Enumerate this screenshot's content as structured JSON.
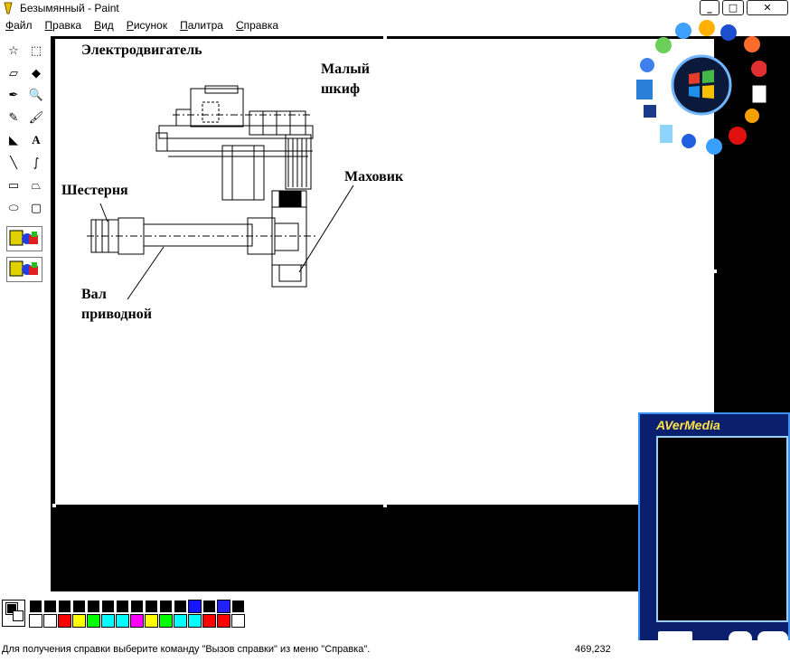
{
  "window": {
    "title": "Безымянный - Paint",
    "minimize_glyph": "_",
    "maximize_glyph": "□",
    "close_glyph": "✕"
  },
  "menu": {
    "items": [
      "Файл",
      "Правка",
      "Вид",
      "Рисунок",
      "Палитра",
      "Справка"
    ]
  },
  "toolbox": {
    "tools": [
      {
        "name": "free-select-icon",
        "glyph": "☆"
      },
      {
        "name": "rect-select-icon",
        "glyph": "⬚"
      },
      {
        "name": "eraser-icon",
        "glyph": "▱"
      },
      {
        "name": "fill-bucket-icon",
        "glyph": "◆"
      },
      {
        "name": "color-picker-icon",
        "glyph": "✒"
      },
      {
        "name": "magnifier-icon",
        "glyph": "🔍"
      },
      {
        "name": "pencil-icon",
        "glyph": "✎"
      },
      {
        "name": "brush-icon",
        "glyph": "🖌"
      },
      {
        "name": "airbrush-icon",
        "glyph": "◣"
      },
      {
        "name": "text-icon",
        "glyph": "A"
      },
      {
        "name": "line-icon",
        "glyph": "╲"
      },
      {
        "name": "curve-icon",
        "glyph": "∫"
      },
      {
        "name": "rectangle-icon",
        "glyph": "▭"
      },
      {
        "name": "polygon-icon",
        "glyph": "⏢"
      },
      {
        "name": "ellipse-icon",
        "glyph": "⬭"
      },
      {
        "name": "rounded-rect-icon",
        "glyph": "▢"
      }
    ]
  },
  "drawing": {
    "labels": {
      "motor": "Электродвигатель",
      "small_pulley_1": "Малый",
      "small_pulley_2": "шкиф",
      "flywheel": "Маховик",
      "gear": "Шестерня",
      "shaft_1": "Вал",
      "shaft_2": "приводной"
    }
  },
  "palette": {
    "top_row": [
      "#000000",
      "#000000",
      "#000000",
      "#000000",
      "#000000",
      "#000000",
      "#000000",
      "#000000",
      "#000000",
      "#000000",
      "#000000",
      "#1515ff",
      "#000000",
      "#2222ff",
      "#000000"
    ],
    "bottom_row": [
      "#ffffff",
      "#ffffff",
      "#ff0000",
      "#ffff00",
      "#00ff00",
      "#00ffff",
      "#00ffff",
      "#ff00ff",
      "#ffff00",
      "#00ff00",
      "#00ffff",
      "#00ffff",
      "#ff0000",
      "#ff0000",
      "#ffffff"
    ]
  },
  "status": {
    "help_text": "Для получения справки выберите команду \"Вызов справки\" из меню \"Справка\".",
    "coordinates": "469,232"
  },
  "overlay": {
    "avermedia_logo": "AVerMedia"
  },
  "colors": {
    "canvas_background": "#000000",
    "canvas": "#ffffff",
    "avermedia_frame": "#0a1f6e",
    "avermedia_accent": "#3a8ff0"
  }
}
